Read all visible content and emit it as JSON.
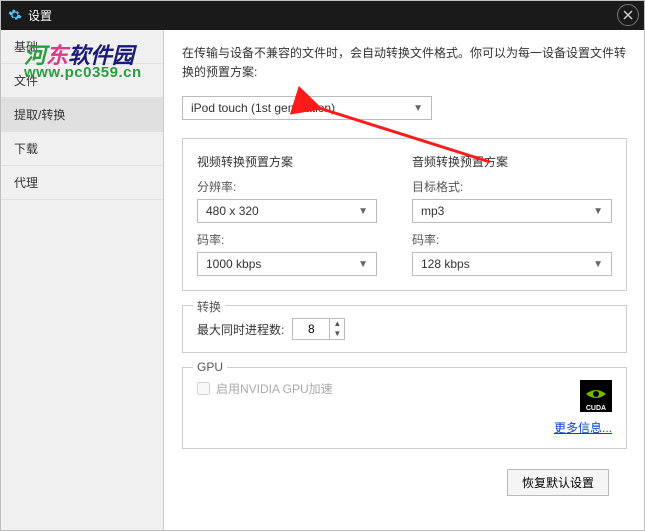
{
  "title": "设置",
  "watermark": {
    "text": "河东软件园",
    "url": "www.pc0359.cn"
  },
  "sidebar": {
    "items": [
      {
        "label": "基础"
      },
      {
        "label": "文件"
      },
      {
        "label": "提取/转换"
      },
      {
        "label": "下载"
      },
      {
        "label": "代理"
      }
    ]
  },
  "desc_text": "在传输与设备不兼容的文件时，会自动转换文件格式。你可以为每一设备设置文件转换的预置方案:",
  "preset_selected": "iPod touch (1st generation)",
  "video": {
    "heading": "视频转换预置方案",
    "resolution_label": "分辨率:",
    "resolution_value": "480 x 320",
    "bitrate_label": "码率:",
    "bitrate_value": "1000 kbps"
  },
  "audio": {
    "heading": "音频转换预置方案",
    "format_label": "目标格式:",
    "format_value": "mp3",
    "bitrate_label": "码率:",
    "bitrate_value": "128 kbps"
  },
  "convert": {
    "legend": "转换",
    "threads_label": "最大同时进程数:",
    "threads_value": "8"
  },
  "gpu": {
    "legend": "GPU",
    "checkbox_label": "启用NVIDIA GPU加速",
    "more_link": "更多信息..."
  },
  "restore_btn": "恢复默认设置"
}
